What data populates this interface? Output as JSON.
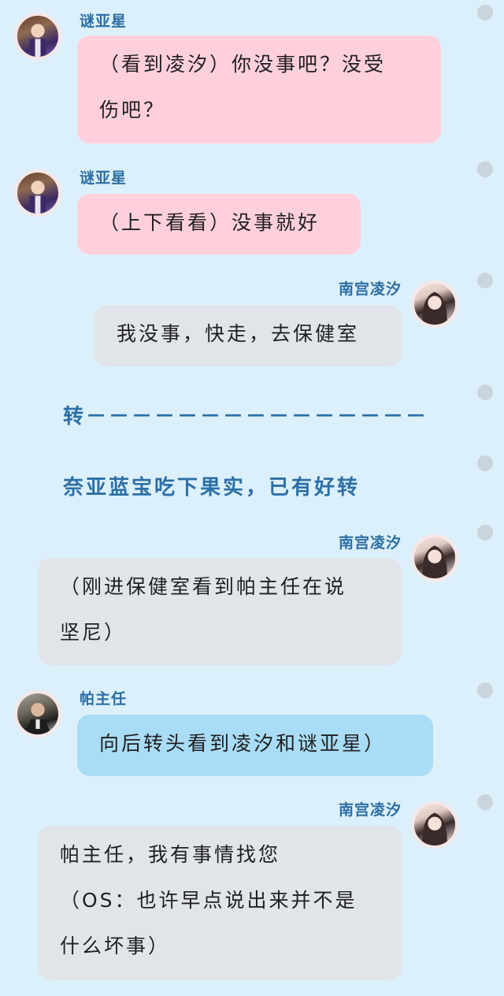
{
  "messages": [
    {
      "sender": "谜亚星",
      "side": "left",
      "avatar": "boy-avatar",
      "lines": [
        "（看到凌汐）你没事吧？没受",
        "伤吧？"
      ]
    },
    {
      "sender": "谜亚星",
      "side": "left",
      "avatar": "boy-avatar",
      "lines": [
        "（上下看看）没事就好"
      ]
    },
    {
      "sender": "南宫凌汐",
      "side": "right",
      "avatar": "girl-avatar",
      "lines": [
        "我没事，快走，去保健室"
      ]
    },
    {
      "sender": "南宫凌汐",
      "side": "right",
      "avatar": "girl-avatar",
      "lines": [
        "（刚进保健室看到帕主任在说",
        "坚尼）"
      ]
    },
    {
      "sender": "帕主任",
      "side": "left",
      "avatar": "man-avatar",
      "lines": [
        "向后转头看到凌汐和谜亚星）"
      ]
    },
    {
      "sender": "南宫凌汐",
      "side": "right",
      "avatar": "girl-avatar",
      "lines": [
        "帕主任，我有事情找您",
        "（OS：也许早点说出来并不是",
        "什么坏事）"
      ]
    }
  ],
  "narrations": [
    "转－－－－－－－－－－－－－－－",
    "奈亚蓝宝吃下果实，已有好转"
  ],
  "colors": {
    "background": "#dcf0fb",
    "pink_bubble": "#ffd0dc",
    "gray_bubble": "#e1e5ea",
    "blue_bubble": "#a9dcf6",
    "name_text": "#2c6ea3",
    "narration_text": "#2d6fa6"
  }
}
